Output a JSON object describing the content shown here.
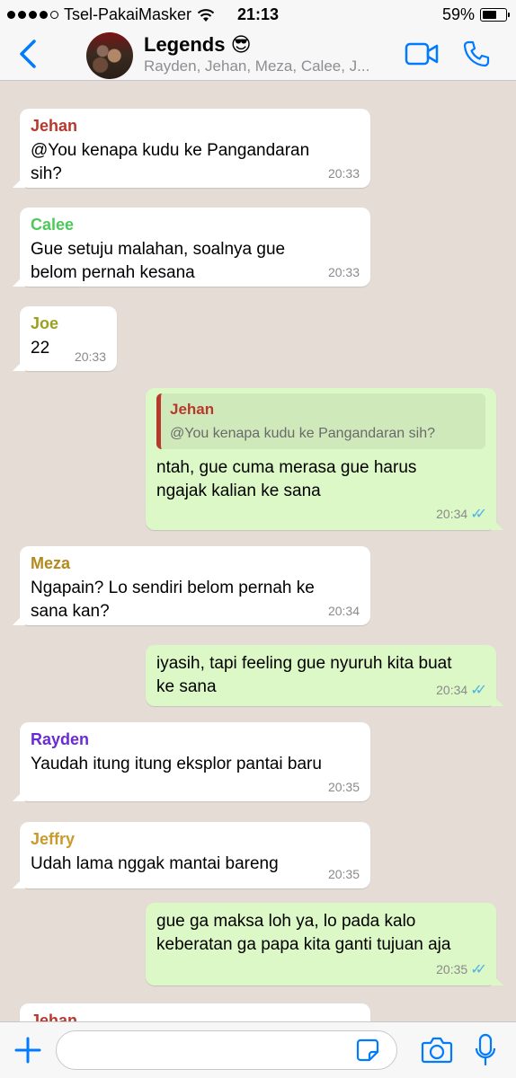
{
  "status_bar": {
    "carrier": "Tsel-PakaiMasker",
    "time": "21:13",
    "battery": "59%",
    "battery_level": 0.59,
    "signal_bars_filled": 4,
    "signal_bars_total": 5
  },
  "header": {
    "title": "Legends 😎",
    "subtitle": "Rayden, Jehan, Meza, Calee, J..."
  },
  "colors": {
    "accent": "#007aff",
    "outgoing_bubble": "#dcf8c6",
    "incoming_bubble": "#ffffff",
    "read_ticks": "#4fb3e5",
    "chat_background": "#e5ddd5"
  },
  "messages": [
    {
      "direction": "in",
      "sender": "Jehan",
      "sender_color": "#b7392c",
      "text": "@You kenapa kudu ke Pangandaran sih?",
      "time": "20:33"
    },
    {
      "direction": "in",
      "sender": "Calee",
      "sender_color": "#4cc85c",
      "text": "Gue setuju malahan, soalnya gue belom pernah kesana",
      "time": "20:33"
    },
    {
      "direction": "in",
      "sender": "Joe",
      "sender_color": "#9aa11e",
      "text": "22",
      "time": "20:33"
    },
    {
      "direction": "out",
      "quote_name": "Jehan",
      "quote_text": "@You kenapa kudu ke Pangandaran sih?",
      "text": "ntah, gue cuma merasa gue harus ngajak kalian ke sana",
      "time": "20:34",
      "ticks": "✓✓"
    },
    {
      "direction": "in",
      "sender": "Meza",
      "sender_color": "#b48a1c",
      "text": "Ngapain? Lo sendiri belom pernah ke sana kan?",
      "time": "20:34"
    },
    {
      "direction": "out",
      "text": "iyasih, tapi feeling gue nyuruh kita buat ke sana",
      "time": "20:34",
      "ticks": "✓✓"
    },
    {
      "direction": "in",
      "sender": "Rayden",
      "sender_color": "#6a2bd6",
      "text": "Yaudah itung itung eksplor pantai baru",
      "time": "20:35"
    },
    {
      "direction": "in",
      "sender": "Jeffry",
      "sender_color": "#c99a2c",
      "text": "Udah lama nggak mantai bareng",
      "time": "20:35"
    },
    {
      "direction": "out",
      "text": "gue ga maksa loh ya, lo pada kalo keberatan ga papa kita ganti tujuan aja",
      "time": "20:35",
      "ticks": "✓✓"
    },
    {
      "direction": "in",
      "sender": "Jehan",
      "sender_color": "#b7392c",
      "text": "",
      "time": ""
    }
  ],
  "input": {
    "value": "",
    "placeholder": ""
  },
  "icons": {
    "back": "chevron-left-icon",
    "video": "video-camera-icon",
    "phone": "phone-icon",
    "add": "plus-icon",
    "sticker": "sticker-icon",
    "camera": "camera-icon",
    "mic": "microphone-icon"
  }
}
